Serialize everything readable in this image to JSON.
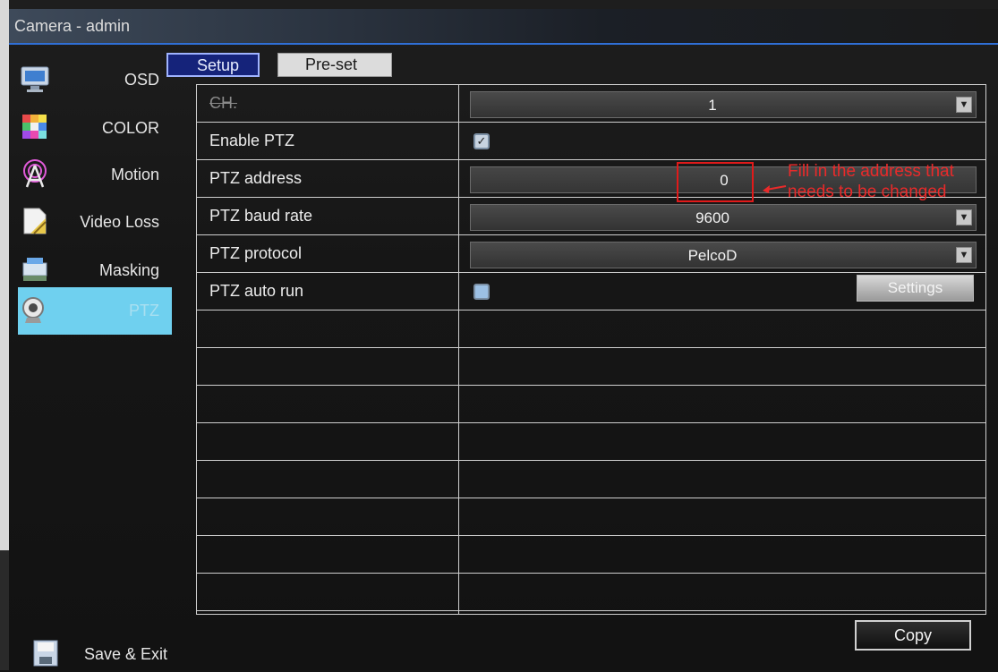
{
  "window": {
    "title": "Camera - admin"
  },
  "sidebar": {
    "items": [
      {
        "label": "OSD",
        "icon": "monitor-icon"
      },
      {
        "label": "COLOR",
        "icon": "color-palette-icon"
      },
      {
        "label": "Motion",
        "icon": "motion-icon"
      },
      {
        "label": "Video Loss",
        "icon": "video-loss-icon"
      },
      {
        "label": "Masking",
        "icon": "masking-icon"
      },
      {
        "label": "PTZ",
        "icon": "webcam-icon",
        "active": true
      }
    ],
    "save_exit": {
      "label": "Save & Exit",
      "icon": "save-icon"
    }
  },
  "tabs": [
    {
      "label": "Setup",
      "active": true
    },
    {
      "label": "Pre-set",
      "active": false
    }
  ],
  "settings": {
    "ch": {
      "label": "CH.",
      "value": "1"
    },
    "enable_ptz": {
      "label": "Enable PTZ",
      "checked": true
    },
    "ptz_address": {
      "label": "PTZ address",
      "value": "0"
    },
    "ptz_baud_rate": {
      "label": "PTZ baud rate",
      "value": "9600"
    },
    "ptz_protocol": {
      "label": "PTZ protocol",
      "value": "PelcoD"
    },
    "ptz_auto_run": {
      "label": "PTZ auto run",
      "checked": false,
      "button": "Settings"
    }
  },
  "footer": {
    "copy_label": "Copy"
  },
  "annotation": {
    "text": "Fill in the address that needs to be changed",
    "color": "#e92a2a"
  }
}
